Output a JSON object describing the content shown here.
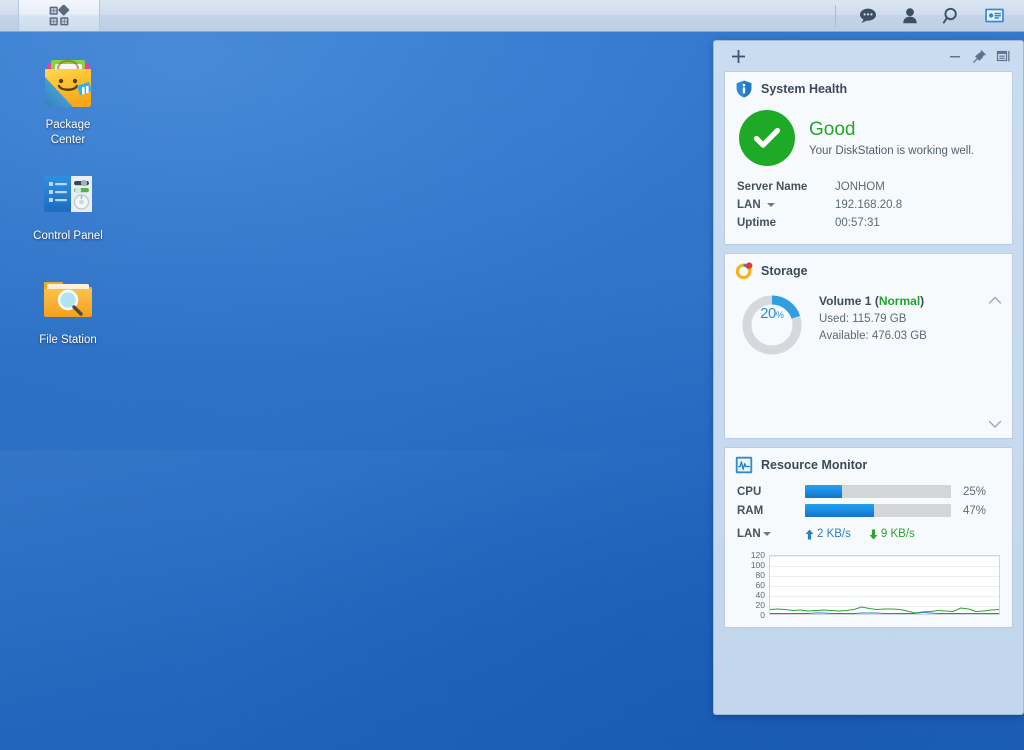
{
  "taskbar": {
    "menu_button": "main-menu",
    "icons": [
      {
        "name": "notifications-icon",
        "glyph": "speech-bubble"
      },
      {
        "name": "user-options-icon",
        "glyph": "person"
      },
      {
        "name": "search-icon",
        "glyph": "magnifier"
      },
      {
        "name": "widgets-icon",
        "glyph": "panel"
      }
    ]
  },
  "desktop": {
    "icons": [
      {
        "label_line1": "Package",
        "label_line2": "Center",
        "name": "package-center"
      },
      {
        "label_line1": "Control Panel",
        "label_line2": "",
        "name": "control-panel"
      },
      {
        "label_line1": "File Station",
        "label_line2": "",
        "name": "file-station"
      }
    ]
  },
  "panel": {
    "add_label": "+",
    "minimize_label": "–",
    "pin_label": "pin",
    "dock_label": "dock"
  },
  "system_health": {
    "title": "System Health",
    "status": "Good",
    "description": "Your DiskStation is working well.",
    "rows": [
      {
        "key": "Server Name",
        "value": "JONHOM",
        "dropdown": false
      },
      {
        "key": "LAN",
        "value": "192.168.20.8",
        "dropdown": true
      },
      {
        "key": "Uptime",
        "value": "00:57:31",
        "dropdown": false
      }
    ]
  },
  "storage": {
    "title": "Storage",
    "percent": "20",
    "percent_unit": "%",
    "percent_value": 20,
    "volume": "Volume 1",
    "state_open": "(",
    "state": "Normal",
    "state_close": ")",
    "used": "Used: 115.79 GB",
    "available": "Available: 476.03 GB"
  },
  "resource_monitor": {
    "title": "Resource Monitor",
    "cpu_label": "CPU",
    "cpu_percent": "25%",
    "cpu_value": 25,
    "ram_label": "RAM",
    "ram_percent": "47%",
    "ram_value": 47,
    "lan_label": "LAN",
    "upload": "2 KB/s",
    "download": "9 KB/s"
  },
  "colors": {
    "accent_blue": "#1b8fe4",
    "good_green": "#24a629",
    "storage_arc": "#2f9fe0",
    "net_down_green": "#2aa52a",
    "desktop_blue": "#2b73cd"
  },
  "chart_data": {
    "type": "line",
    "title": "",
    "xlabel": "",
    "ylabel": "",
    "ylim": [
      0,
      120
    ],
    "yticks": [
      120,
      100,
      80,
      60,
      40,
      20,
      0
    ],
    "grid": true,
    "legend": "none",
    "series": [
      {
        "name": "Download (KB/s)",
        "color": "#2aa52a",
        "values": [
          13,
          14,
          13,
          11,
          12,
          10,
          11,
          12,
          11,
          10,
          11,
          13,
          18,
          15,
          13,
          14,
          14,
          13,
          10,
          6,
          8,
          9,
          11,
          10,
          9,
          16,
          14,
          9,
          10,
          12,
          13
        ]
      },
      {
        "name": "Upload (KB/s)",
        "color": "#2a7fc4",
        "values": [
          5,
          5,
          5,
          5,
          5,
          5,
          6,
          6,
          5,
          5,
          5,
          5,
          6,
          6,
          6,
          5,
          5,
          5,
          5,
          5,
          7,
          6,
          5,
          5,
          5,
          5,
          5,
          5,
          5,
          5,
          5
        ]
      }
    ]
  }
}
